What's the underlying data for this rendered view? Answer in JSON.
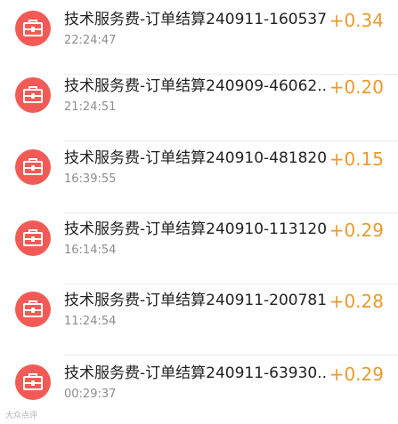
{
  "transactions": [
    {
      "title": "技术服务费-订单结算240911-160537...",
      "time": "22:24:47",
      "amount": "+0.34"
    },
    {
      "title": "技术服务费-订单结算240909-46062...",
      "time": "21:24:51",
      "amount": "+0.20"
    },
    {
      "title": "技术服务费-订单结算240910-481820...",
      "time": "16:39:55",
      "amount": "+0.15"
    },
    {
      "title": "技术服务费-订单结算240910-113120...",
      "time": "16:14:54",
      "amount": "+0.29"
    },
    {
      "title": "技术服务费-订单结算240911-200781...",
      "time": "11:24:54",
      "amount": "+0.28"
    },
    {
      "title": "技术服务费-订单结算240911-63930...",
      "time": "00:29:37",
      "amount": "+0.29"
    }
  ],
  "icon": "briefcase-icon",
  "colors": {
    "icon_background": "#f25b55",
    "amount": "#ea9a2e",
    "title": "#222222",
    "time": "#8d8d8d"
  },
  "watermark": "大众点评"
}
